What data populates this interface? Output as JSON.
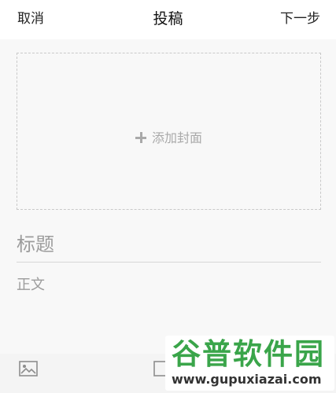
{
  "header": {
    "cancel_label": "取消",
    "title": "投稿",
    "next_label": "下一步"
  },
  "cover": {
    "add_label": "添加封面"
  },
  "editor": {
    "title_placeholder": "标题",
    "body_placeholder": "正文"
  },
  "toolbar": {
    "image_icon": "image-icon",
    "second_icon": "layout-icon"
  },
  "watermark": {
    "title": "谷普软件园",
    "url": "www.gupuxiazai.com"
  }
}
